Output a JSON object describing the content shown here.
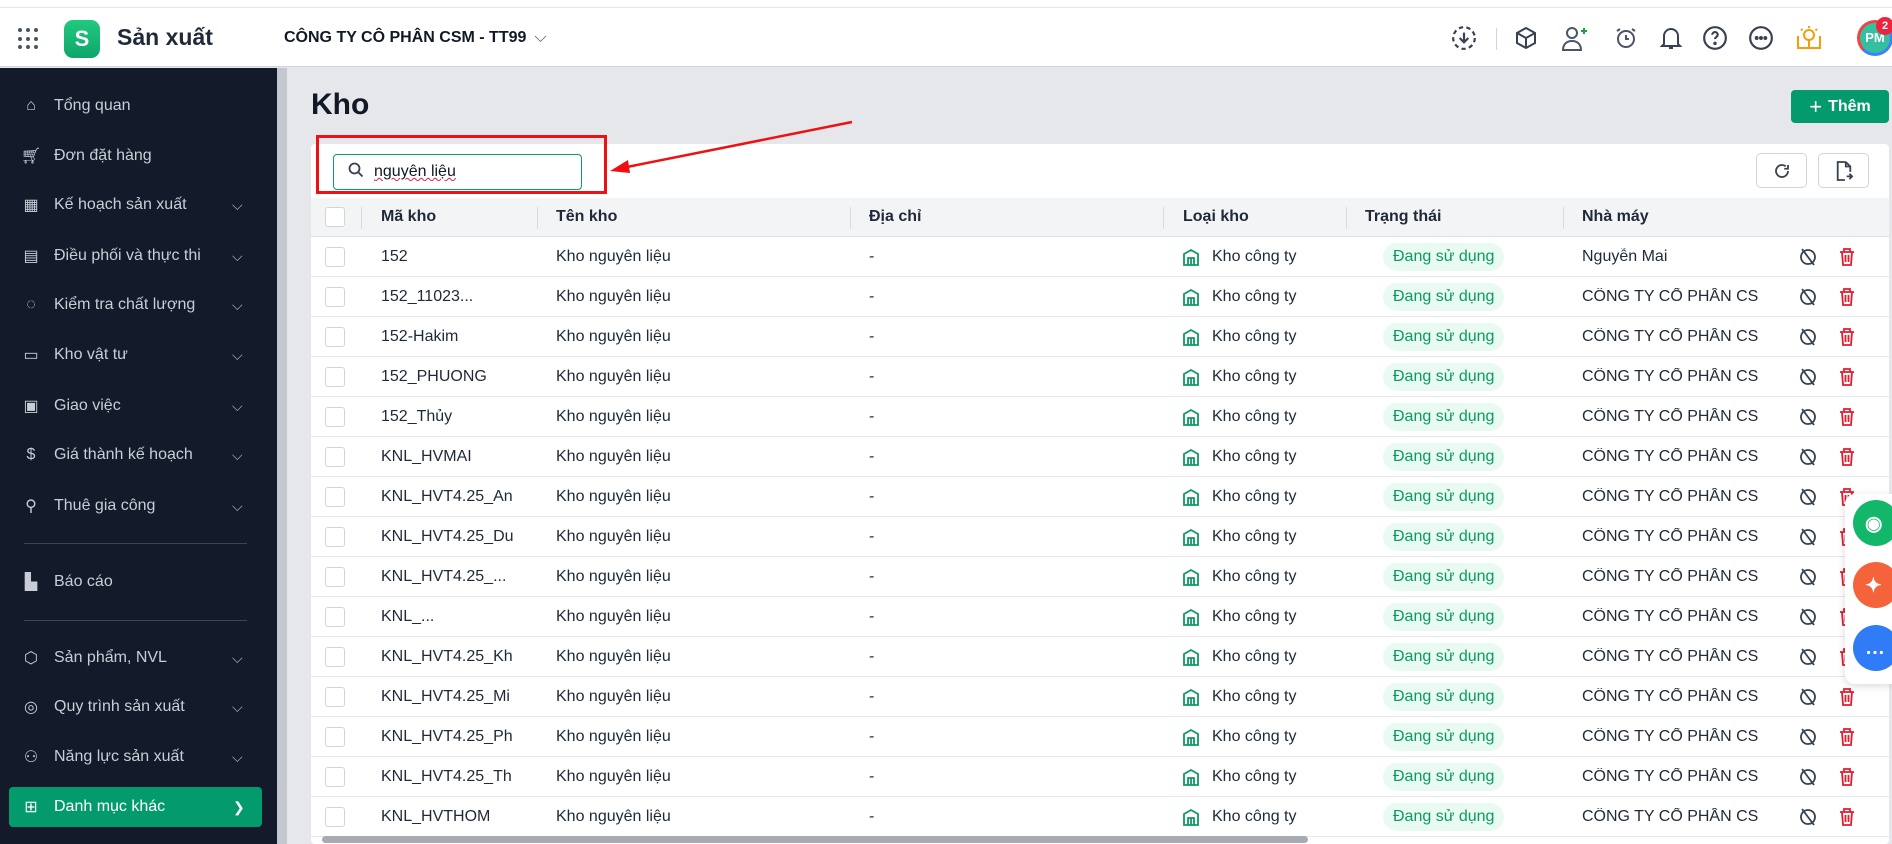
{
  "header": {
    "app_title": "Sản xuất",
    "company": "CÔNG TY CÔ PHÂN CSM - TT99",
    "avatar_initials": "PM",
    "notification_count": "2"
  },
  "sidebar": {
    "items": [
      {
        "label": "Tổng quan",
        "icon": "home-icon",
        "chevron": false
      },
      {
        "label": "Đơn đặt hàng",
        "icon": "cart-icon",
        "chevron": false
      },
      {
        "label": "Kế hoạch sản xuất",
        "icon": "calendar-icon",
        "chevron": true
      },
      {
        "label": "Điều phối và thực thi",
        "icon": "schedule-icon",
        "chevron": true
      },
      {
        "label": "Kiểm tra chất lượng",
        "icon": "check-circle-icon",
        "chevron": true
      },
      {
        "label": "Kho vật tư",
        "icon": "archive-icon",
        "chevron": true
      },
      {
        "label": "Giao việc",
        "icon": "clipboard-icon",
        "chevron": true
      },
      {
        "label": "Giá thành kế hoạch",
        "icon": "receipt-icon",
        "chevron": true
      },
      {
        "label": "Thuê gia công",
        "icon": "wrench-icon",
        "chevron": true
      },
      {
        "label": "Báo cáo",
        "icon": "chart-icon",
        "chevron": false
      },
      {
        "label": "Sản phẩm, NVL",
        "icon": "box-icon",
        "chevron": true
      },
      {
        "label": "Quy trình sản xuất",
        "icon": "process-icon",
        "chevron": true
      },
      {
        "label": "Năng lực sản xuất",
        "icon": "user-gear-icon",
        "chevron": true
      },
      {
        "label": "Danh mục khác",
        "icon": "grid-icon",
        "chevron": true,
        "active": true
      }
    ]
  },
  "page": {
    "title": "Kho",
    "add_label": "Thêm"
  },
  "search": {
    "value": "nguyên liệu"
  },
  "table": {
    "columns": [
      "Mã kho",
      "Tên kho",
      "Địa chỉ",
      "Loại kho",
      "Trạng thái",
      "Nhà máy"
    ],
    "rows": [
      [
        "152",
        "Kho nguyên liệu",
        "-",
        "Kho công ty",
        "Đang sử dụng",
        "Nguyễn Mai"
      ],
      [
        "152_11023...",
        "Kho nguyên liệu",
        "-",
        "Kho công ty",
        "Đang sử dụng",
        "CÔNG TY CỔ PHẦN CS"
      ],
      [
        "152-Hakim",
        "Kho nguyên liệu",
        "-",
        "Kho công ty",
        "Đang sử dụng",
        "CÔNG TY CỔ PHẦN CS"
      ],
      [
        "152_PHUONG",
        "Kho nguyên liệu",
        "-",
        "Kho công ty",
        "Đang sử dụng",
        "CÔNG TY CỔ PHẦN CS"
      ],
      [
        "152_Thủy",
        "Kho nguyên liệu",
        "-",
        "Kho công ty",
        "Đang sử dụng",
        "CÔNG TY CỔ PHẦN CS"
      ],
      [
        "KNL_HVMAI",
        "Kho nguyên liệu",
        "-",
        "Kho công ty",
        "Đang sử dụng",
        "CÔNG TY CỔ PHẦN CS"
      ],
      [
        "KNL_HVT4.25_An",
        "Kho nguyên liệu",
        "-",
        "Kho công ty",
        "Đang sử dụng",
        "CÔNG TY CỔ PHẦN CS"
      ],
      [
        "KNL_HVT4.25_Du",
        "Kho nguyên liệu",
        "-",
        "Kho công ty",
        "Đang sử dụng",
        "CÔNG TY CỔ PHẦN CS"
      ],
      [
        "KNL_HVT4.25_...",
        "Kho nguyên liệu",
        "-",
        "Kho công ty",
        "Đang sử dụng",
        "CÔNG TY CỔ PHẦN CS"
      ],
      [
        "KNL_...",
        "Kho nguyên liệu",
        "-",
        "Kho công ty",
        "Đang sử dụng",
        "CÔNG TY CỔ PHẦN CS"
      ],
      [
        "KNL_HVT4.25_Kh",
        "Kho nguyên liệu",
        "-",
        "Kho công ty",
        "Đang sử dụng",
        "CÔNG TY CỔ PHẦN CS"
      ],
      [
        "KNL_HVT4.25_Mi",
        "Kho nguyên liệu",
        "-",
        "Kho công ty",
        "Đang sử dụng",
        "CÔNG TY CỔ PHẦN CS"
      ],
      [
        "KNL_HVT4.25_Ph",
        "Kho nguyên liệu",
        "-",
        "Kho công ty",
        "Đang sử dụng",
        "CÔNG TY CỔ PHẦN CS"
      ],
      [
        "KNL_HVT4.25_Th",
        "Kho nguyên liệu",
        "-",
        "Kho công ty",
        "Đang sử dụng",
        "CÔNG TY CỔ PHẦN CS"
      ],
      [
        "KNL_HVTHOM",
        "Kho nguyên liệu",
        "-",
        "Kho công ty",
        "Đang sử dụng",
        "CÔNG TY CỔ PHẦN CS"
      ]
    ]
  },
  "colors": {
    "primary": "#039b6c",
    "sidebar": "#131a29",
    "danger": "#e11d2e",
    "annotation": "#ee1111"
  }
}
